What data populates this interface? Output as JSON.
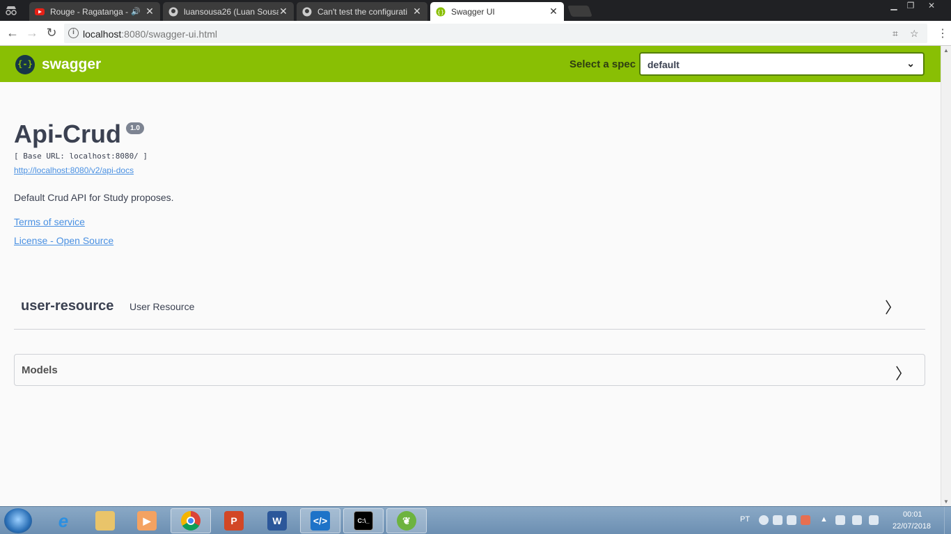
{
  "browser": {
    "tabs": [
      {
        "title": "Rouge - Ragatanga - ",
        "favicon": "youtube-icon",
        "audio": true
      },
      {
        "title": "luansousa26 (Luan Sousa",
        "favicon": "github-icon"
      },
      {
        "title": "Can't test the configurati",
        "favicon": "github-icon"
      },
      {
        "title": "Swagger UI",
        "favicon": "swagger-icon",
        "active": true
      }
    ],
    "url_host": "localhost",
    "url_rest": ":8080/swagger-ui.html"
  },
  "topbar": {
    "logo_text": "swagger",
    "logo_glyph": "{-}",
    "spec_label": "Select a spec",
    "spec_value": "default"
  },
  "info": {
    "title": "Api-Crud",
    "version": "1.0",
    "base_url": "[ Base URL: localhost:8080/ ]",
    "docs_url": "http://localhost:8080/v2/api-docs",
    "description": "Default Crud API for Study proposes.",
    "terms": "Terms of service",
    "license": "License - Open Source"
  },
  "tags": [
    {
      "name": "user-resource",
      "description": "User Resource"
    }
  ],
  "models": {
    "title": "Models"
  },
  "taskbar": {
    "lang": "PT",
    "time": "00:01",
    "date": "22/07/2018"
  },
  "colors": {
    "swagger_green": "#89bf04",
    "link": "#4990e2",
    "text": "#3b4151"
  }
}
